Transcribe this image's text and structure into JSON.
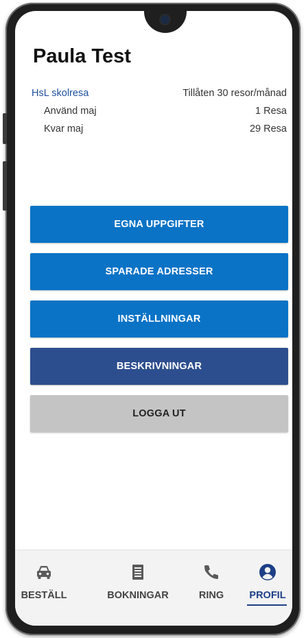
{
  "profile": {
    "name": "Paula Test",
    "rows": [
      {
        "label": "HsL skolresa",
        "value": "Tillåten 30 resor/månad"
      },
      {
        "label": "Använd maj",
        "value": "1 Resa"
      },
      {
        "label": "Kvar maj",
        "value": "29 Resa"
      }
    ]
  },
  "buttons": {
    "egna": "EGNA UPPGIFTER",
    "sparade": "SPARADE ADRESSER",
    "installningar": "INSTÄLLNINGAR",
    "beskrivningar": "BESKRIVNINGAR",
    "logga_ut": "LOGGA UT"
  },
  "nav": {
    "items": [
      {
        "label": "BESTÄLL",
        "icon": "car-icon"
      },
      {
        "label": "BOKNINGAR",
        "icon": "list-icon"
      },
      {
        "label": "RING",
        "icon": "phone-icon"
      },
      {
        "label": "PROFIL",
        "icon": "profile-icon",
        "active": true
      }
    ]
  },
  "colors": {
    "primary_blue": "#0a73c6",
    "dark_blue": "#2d4e8e",
    "grey_button": "#c4c4c4",
    "active_nav": "#1d3f86"
  }
}
